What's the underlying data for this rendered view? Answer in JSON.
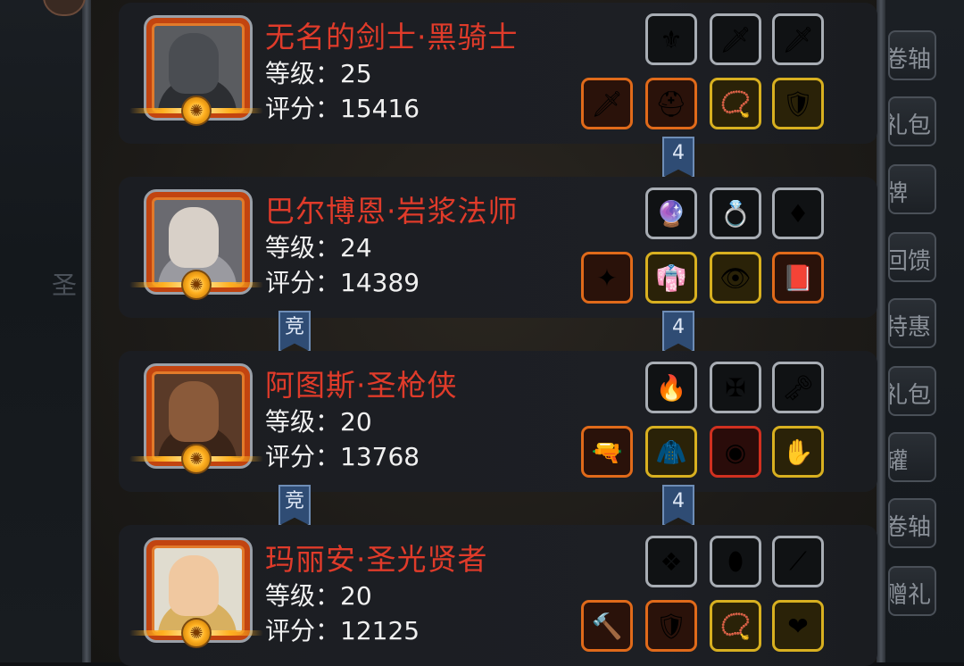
{
  "background": {
    "left_char": "圣",
    "side_menu": [
      "卷轴",
      "礼包",
      "牌",
      "回馈",
      "特惠",
      "礼包",
      "罐",
      "卷轴",
      "赠礼"
    ]
  },
  "heroes": [
    {
      "name": "无名的剑士·黑骑士",
      "level_label": "等级：25",
      "score_label": "评分：15416",
      "portrait": "dark-knight-helmet",
      "equipment": {
        "top": [
          {
            "icon": "gold-skull-amulet",
            "tier": "gray",
            "glyph": "⚜"
          },
          {
            "icon": "dark-gauntlet",
            "tier": "gray",
            "glyph": "🗡"
          },
          {
            "icon": "dark-gauntlet-2",
            "tier": "gray",
            "glyph": "🗡"
          }
        ],
        "bottom": [
          {
            "icon": "greatsword",
            "tier": "orange",
            "glyph": "🗡"
          },
          {
            "icon": "red-helmet",
            "tier": "orange",
            "glyph": "⛑"
          },
          {
            "icon": "green-necklace",
            "tier": "gold",
            "glyph": "📿"
          },
          {
            "icon": "chest-armor",
            "tier": "gold",
            "glyph": "🛡"
          }
        ]
      },
      "tags": {
        "left": "",
        "right": "4"
      }
    },
    {
      "name": "巴尔博恩·岩浆法师",
      "level_label": "等级：24",
      "score_label": "评分：14389",
      "portrait": "elf-mage",
      "equipment": {
        "top": [
          {
            "icon": "blue-orb",
            "tier": "gray",
            "glyph": "🔮"
          },
          {
            "icon": "pink-gem-ring",
            "tier": "gray",
            "glyph": "💍"
          },
          {
            "icon": "red-gem",
            "tier": "gray",
            "glyph": "♦"
          }
        ],
        "bottom": [
          {
            "icon": "magic-staff",
            "tier": "orange",
            "glyph": "✦"
          },
          {
            "icon": "white-robe",
            "tier": "gold",
            "glyph": "👘"
          },
          {
            "icon": "eye-amulet",
            "tier": "gold",
            "glyph": "👁"
          },
          {
            "icon": "spell-book",
            "tier": "orange",
            "glyph": "📕"
          }
        ]
      },
      "tags": {
        "left": "竞",
        "right": "4"
      }
    },
    {
      "name": "阿图斯·圣枪侠",
      "level_label": "等级：20",
      "score_label": "评分：13768",
      "portrait": "gunslinger-hat",
      "equipment": {
        "top": [
          {
            "icon": "fire-orb",
            "tier": "gray",
            "glyph": "🔥"
          },
          {
            "icon": "silver-badge",
            "tier": "gray",
            "glyph": "✠"
          },
          {
            "icon": "gold-key",
            "tier": "gray",
            "glyph": "🗝"
          }
        ],
        "bottom": [
          {
            "icon": "flintlock-pistol",
            "tier": "orange",
            "glyph": "🔫"
          },
          {
            "icon": "blue-coat",
            "tier": "gold",
            "glyph": "🧥"
          },
          {
            "icon": "red-eye-gem",
            "tier": "red",
            "glyph": "◉"
          },
          {
            "icon": "gauntlet",
            "tier": "gold",
            "glyph": "✋"
          }
        ]
      },
      "tags": {
        "left": "竞",
        "right": "4"
      }
    },
    {
      "name": "玛丽安·圣光贤者",
      "level_label": "等级：20",
      "score_label": "评分：12125",
      "portrait": "blonde-sage",
      "equipment": {
        "top": [
          {
            "icon": "green-crystal",
            "tier": "gray",
            "glyph": "❖"
          },
          {
            "icon": "teal-stone",
            "tier": "gray",
            "glyph": "⬮"
          },
          {
            "icon": "wooden-wand",
            "tier": "gray",
            "glyph": "⟋"
          }
        ],
        "bottom": [
          {
            "icon": "war-hammer",
            "tier": "orange",
            "glyph": "🔨"
          },
          {
            "icon": "purple-armor",
            "tier": "orange",
            "glyph": "🛡"
          },
          {
            "icon": "blue-pendant",
            "tier": "gold",
            "glyph": "📿"
          },
          {
            "icon": "heart-necklace",
            "tier": "gold",
            "glyph": "❤"
          }
        ]
      },
      "tags": {
        "left": "",
        "right": ""
      }
    }
  ]
}
